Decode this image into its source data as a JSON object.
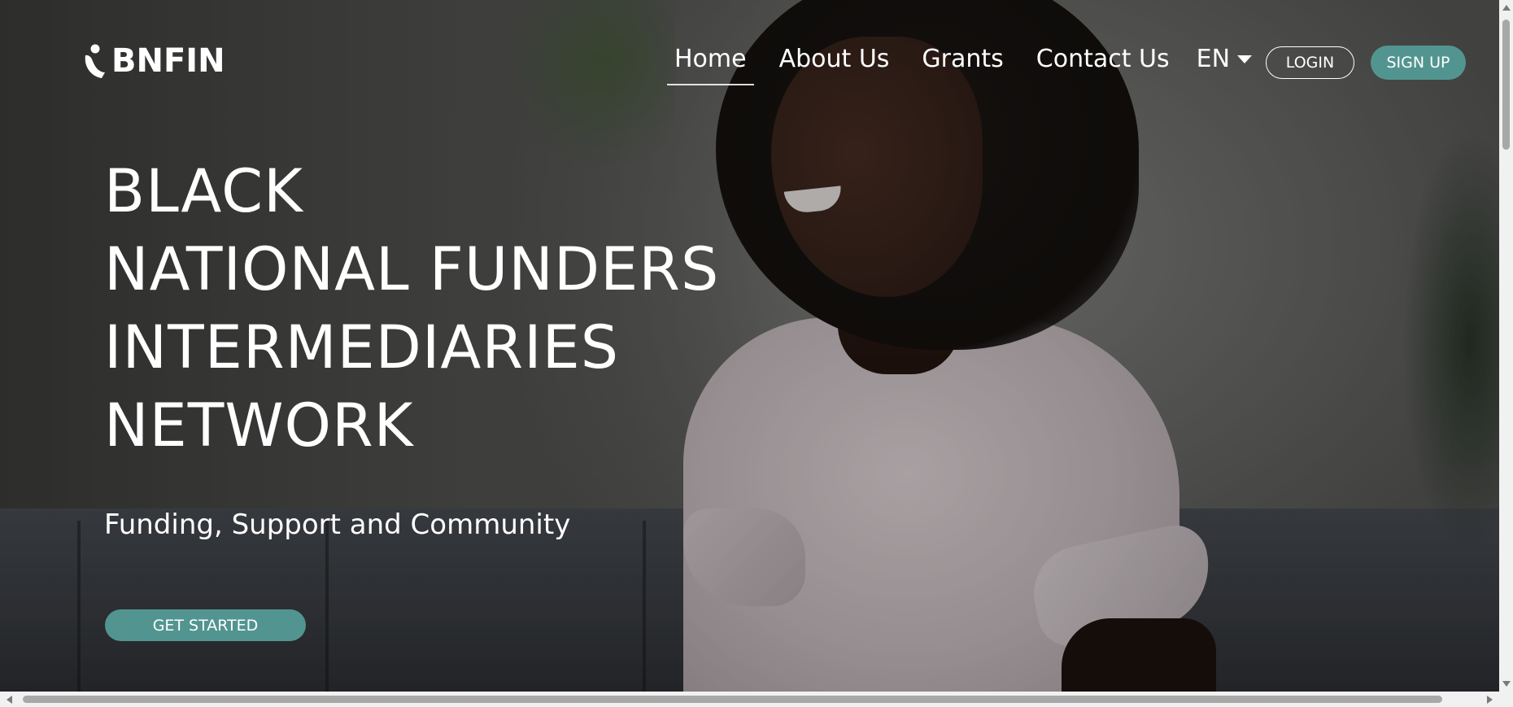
{
  "brand": {
    "name": "BNFIN",
    "logo_icon": "person-logo-icon"
  },
  "nav": {
    "items": [
      {
        "label": "Home",
        "active": true
      },
      {
        "label": "About Us",
        "active": false
      },
      {
        "label": "Grants",
        "active": false
      },
      {
        "label": "Contact Us",
        "active": false
      }
    ],
    "language": {
      "label": "EN",
      "icon": "caret-down-icon"
    },
    "login_label": "LOGIN",
    "signup_label": "SIGN UP"
  },
  "hero": {
    "title_lines": [
      "BLACK",
      "NATIONAL FUNDERS",
      "INTERMEDIARIES",
      "NETWORK"
    ],
    "subtitle": "Funding, Support and Community",
    "cta_label": "GET STARTED"
  },
  "colors": {
    "accent": "#529590",
    "text": "#ffffff"
  }
}
